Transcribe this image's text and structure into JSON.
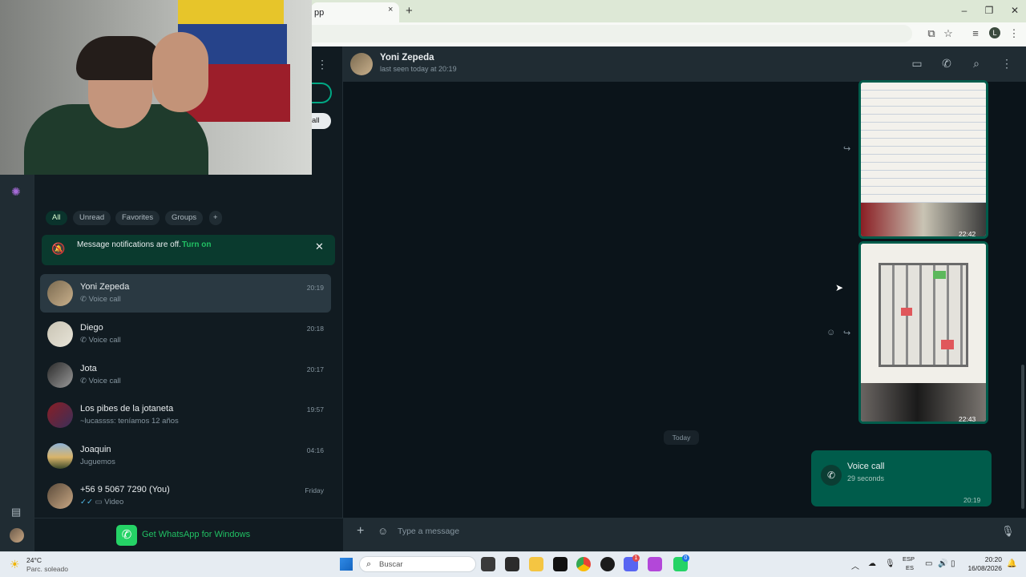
{
  "browser": {
    "tab_title": "pp",
    "tab_close": "×",
    "new_tab": "+",
    "window_controls": [
      "–",
      "❐",
      "✕"
    ],
    "profile_initial": "L"
  },
  "sidebar": {
    "filters": [
      "All",
      "Unread",
      "Favorites",
      "Groups"
    ],
    "add_filter": "+",
    "view_all": "all",
    "notification": {
      "text": "Message notifications are off.",
      "action": "Turn on"
    },
    "chats": [
      {
        "name": "Yoni Zepeda",
        "time": "20:19",
        "preview": "Voice call",
        "icon": "call-icon",
        "selected": true
      },
      {
        "name": "Diego",
        "time": "20:18",
        "preview": "Voice call",
        "icon": "call-icon"
      },
      {
        "name": "Jota",
        "time": "20:17",
        "preview": "Voice call",
        "icon": "call-icon"
      },
      {
        "name": "Los pibes de la jotaneta",
        "time": "19:57",
        "preview": "~lucassss: teníamos 12 años"
      },
      {
        "name": "Joaquin",
        "time": "04:16",
        "preview": "Juguemos"
      },
      {
        "name": "+56 9 5067 7290 (You)",
        "time": "Friday",
        "preview": "Video",
        "icon": "video-icon"
      }
    ],
    "get_app": "Get WhatsApp for Windows"
  },
  "chat": {
    "contact_name": "Yoni Zepeda",
    "status": "last seen today at 20:19",
    "messages": [
      {
        "type": "image",
        "time": "22:42"
      },
      {
        "type": "image",
        "time": "22:43"
      }
    ],
    "date_divider": "Today",
    "call": {
      "title": "Voice call",
      "duration": "29 seconds",
      "time": "20:19"
    },
    "input_placeholder": "Type a message"
  },
  "taskbar": {
    "weather_temp": "24°C",
    "weather_desc": "Parc. soleado",
    "search_placeholder": "Buscar",
    "lang_top": "ESP",
    "lang_bottom": "ES",
    "clock_time": "20:20",
    "clock_date": "16/08/2026",
    "badges": {
      "discord": "1",
      "whatsapp": "0"
    }
  },
  "colors": {
    "accent": "#00a884",
    "bubble_out": "#005c4b",
    "panel": "#202c33",
    "background": "#0b141a"
  }
}
